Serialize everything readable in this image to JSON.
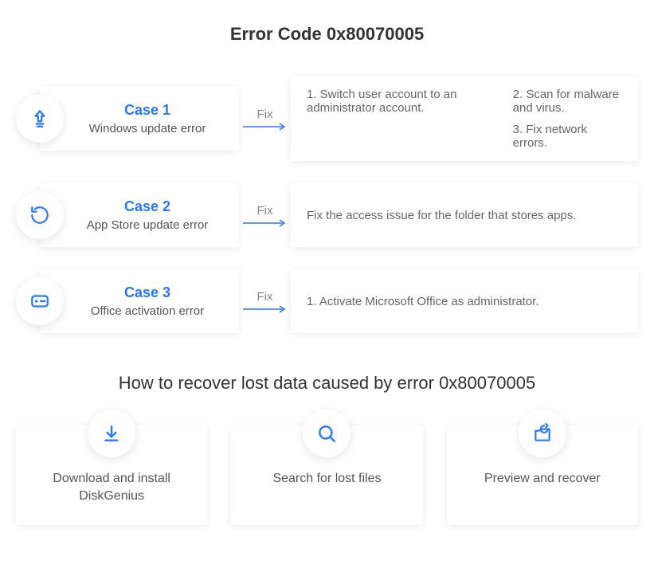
{
  "page_title": "Error Code 0x80070005",
  "accent_color": "#2878ff",
  "cases": [
    {
      "icon": "upload-bulb-icon",
      "title": "Case 1",
      "desc": "Windows update error",
      "arrow_label": "Fix",
      "fixes_col1": [
        "1. Switch user account to an administrator account."
      ],
      "fixes_col2": [
        "2. Scan for malware and virus.",
        "3. Fix network errors."
      ]
    },
    {
      "icon": "refresh-circle-icon",
      "title": "Case 2",
      "desc": "App Store update error",
      "arrow_label": "Fix",
      "fixes_single": "Fix the access issue for the folder that stores apps."
    },
    {
      "icon": "storage-icon",
      "title": "Case 3",
      "desc": "Office activation error",
      "arrow_label": "Fix",
      "fixes_single": "1. Activate Microsoft Office as administrator."
    }
  ],
  "section_title": "How to recover lost data caused by error 0x80070005",
  "steps": [
    {
      "icon": "download-icon",
      "text": "Download and install DiskGenius"
    },
    {
      "icon": "search-icon",
      "text": "Search for lost files"
    },
    {
      "icon": "recover-icon",
      "text": "Preview and recover"
    }
  ]
}
